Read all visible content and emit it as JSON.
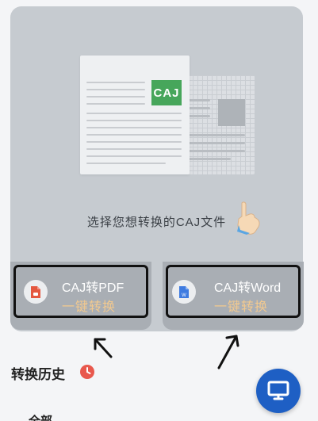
{
  "hero": {
    "badge": "CAJ",
    "caption": "选择您想转换的CAJ文件"
  },
  "cards": [
    {
      "title": "CAJ转PDF",
      "subtitle": "一键转换",
      "icon": "pdf-file-icon"
    },
    {
      "title": "CAJ转Word",
      "subtitle": "一键转换",
      "icon": "word-file-icon"
    }
  ],
  "history": {
    "title": "转换历史",
    "icon": "clock-icon",
    "tab_partial": "全部"
  },
  "fab": {
    "icon": "monitor-icon"
  },
  "colors": {
    "accent_blue": "#1e5fc4",
    "caj_green": "#47a65b",
    "subtitle_gold": "#f2c98f",
    "clock_red": "#e8584d"
  }
}
